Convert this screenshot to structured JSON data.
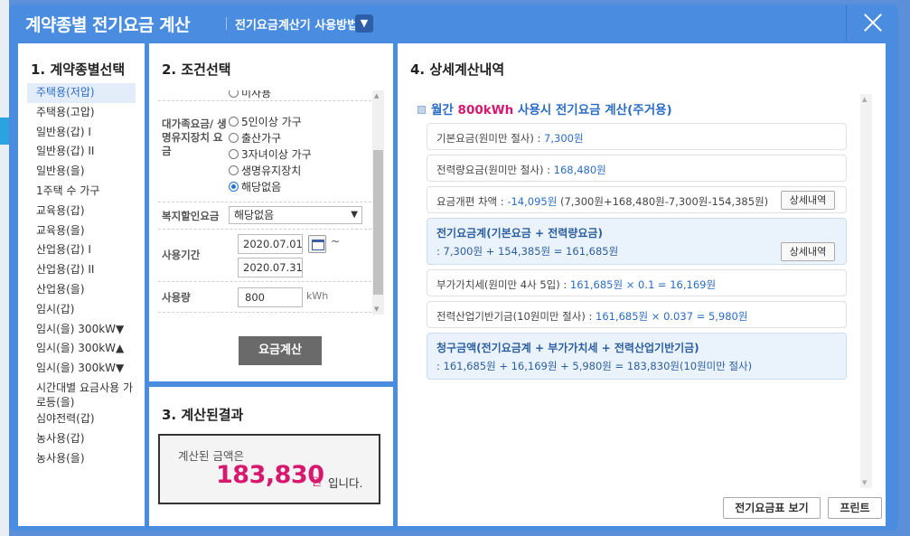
{
  "dialog": {
    "title": "계약종별 전기요금 계산",
    "subtitle": "전기요금계산기 사용방법",
    "toggle_icon": "chevron-down-icon",
    "close_icon": "close-icon"
  },
  "panel1": {
    "title": "1. 계약종별선택",
    "items": [
      "주택용(저압)",
      "주택용(고압)",
      "일반용(갑) I",
      "일반용(갑) II",
      "일반용(을)",
      "1주택 수 가구",
      "교육용(갑)",
      "교육용(을)",
      "산업용(갑) I",
      "산업용(갑) II",
      "산업용(을)",
      "임시(갑)",
      "임시(을) 300kW▼",
      "임시(을) 300kW▲",
      "임시(을) 300kW▼",
      "시간대별 요금사용 가로등(을)",
      "심야전력(갑)",
      "농사용(갑)",
      "농사용(을)"
    ],
    "selected_index": 0
  },
  "panel2": {
    "title": "2. 조건선택",
    "partial_option": "미사용",
    "discount_label": "대가족요금/ 생명유지장치 요금",
    "discount_options": [
      "5인이상 가구",
      "출산가구",
      "3자녀이상 가구",
      "생명유지장치",
      "해당없음"
    ],
    "discount_selected": "해당없음",
    "welfare_label": "복지할인요금",
    "welfare_value": "해당없음",
    "period_label": "사용기간",
    "period_start": "2020.07.01",
    "period_end": "2020.07.31",
    "period_separator": "~",
    "usage_label": "사용량",
    "usage_value": "800",
    "usage_unit": "kWh",
    "calc_button": "요금계산"
  },
  "panel3": {
    "title": "3. 계산된결과",
    "label": "계산된 금액은",
    "amount": "183,830",
    "unit": "원",
    "suffix": "입니다."
  },
  "panel4": {
    "title": "4. 상세계산내역",
    "heading_prefix": "월간",
    "heading_usage": "800kWh",
    "heading_suffix": "사용시 전기요금 계산(주거용)",
    "rows": [
      {
        "label": "기본요금(원미만 절사) :",
        "value": "7,300원"
      },
      {
        "label": "전력량요금(원미만 절사) :",
        "value": "168,480원"
      },
      {
        "label": "요금개편 차액 :",
        "value": "-14,095원",
        "extra": "(7,300원+168,480원-7,300원-154,385원)",
        "button": "상세내역"
      },
      {
        "label": "전기요금계(기본요금 + 전력량요금)",
        "value": ": 7,300원 + 154,385원 = 161,685원",
        "button": "상세내역"
      },
      {
        "label": "부가가치세(원미만 4사 5입) :",
        "value": "161,685원 × 0.1 = 16,169원"
      },
      {
        "label": "전력산업기반기금(10원미만 절사) :",
        "value": "161,685원 × 0.037 = 5,980원"
      },
      {
        "label": "청구금액(전기요금계 + 부가가치세 + 전력산업기반기금)",
        "value": ": 161,685원 + 16,169원 + 5,980원 = 183,830원(10원미만 절사)"
      }
    ],
    "btn_table": "전기요금표 보기",
    "btn_print": "프린트"
  },
  "colors": {
    "frame": "#4a8de0",
    "accent_blue": "#2c6cc4",
    "accent_pink": "#d6196e",
    "button_dark": "#6a6a6a"
  }
}
